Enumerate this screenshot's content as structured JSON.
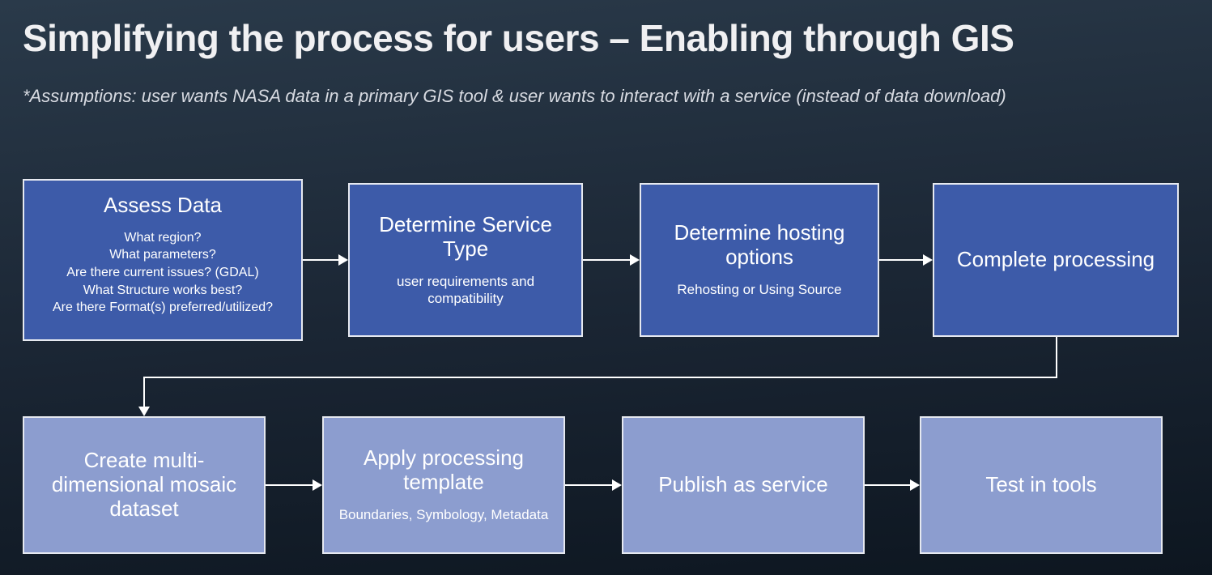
{
  "title": "Simplifying the process for users – Enabling through GIS",
  "assumptions": "*Assumptions: user wants NASA data in a primary GIS tool & user wants to interact with a service (instead of data download)",
  "row1": {
    "b1": {
      "title": "Assess Data",
      "l1": "What region?",
      "l2": "What parameters?",
      "l3": "Are there current issues? (GDAL)",
      "l4": "What Structure works best?",
      "l5": "Are there Format(s) preferred/utilized?"
    },
    "b2": {
      "title": "Determine Service Type",
      "sub": "user requirements and compatibility"
    },
    "b3": {
      "title": "Determine hosting options",
      "sub": "Rehosting or Using Source"
    },
    "b4": {
      "title": "Complete processing"
    }
  },
  "row2": {
    "b1": {
      "title": "Create multi-dimensional mosaic dataset"
    },
    "b2": {
      "title": "Apply processing template",
      "sub": "Boundaries, Symbology, Metadata"
    },
    "b3": {
      "title": "Publish as service"
    },
    "b4": {
      "title": "Test in tools"
    }
  }
}
